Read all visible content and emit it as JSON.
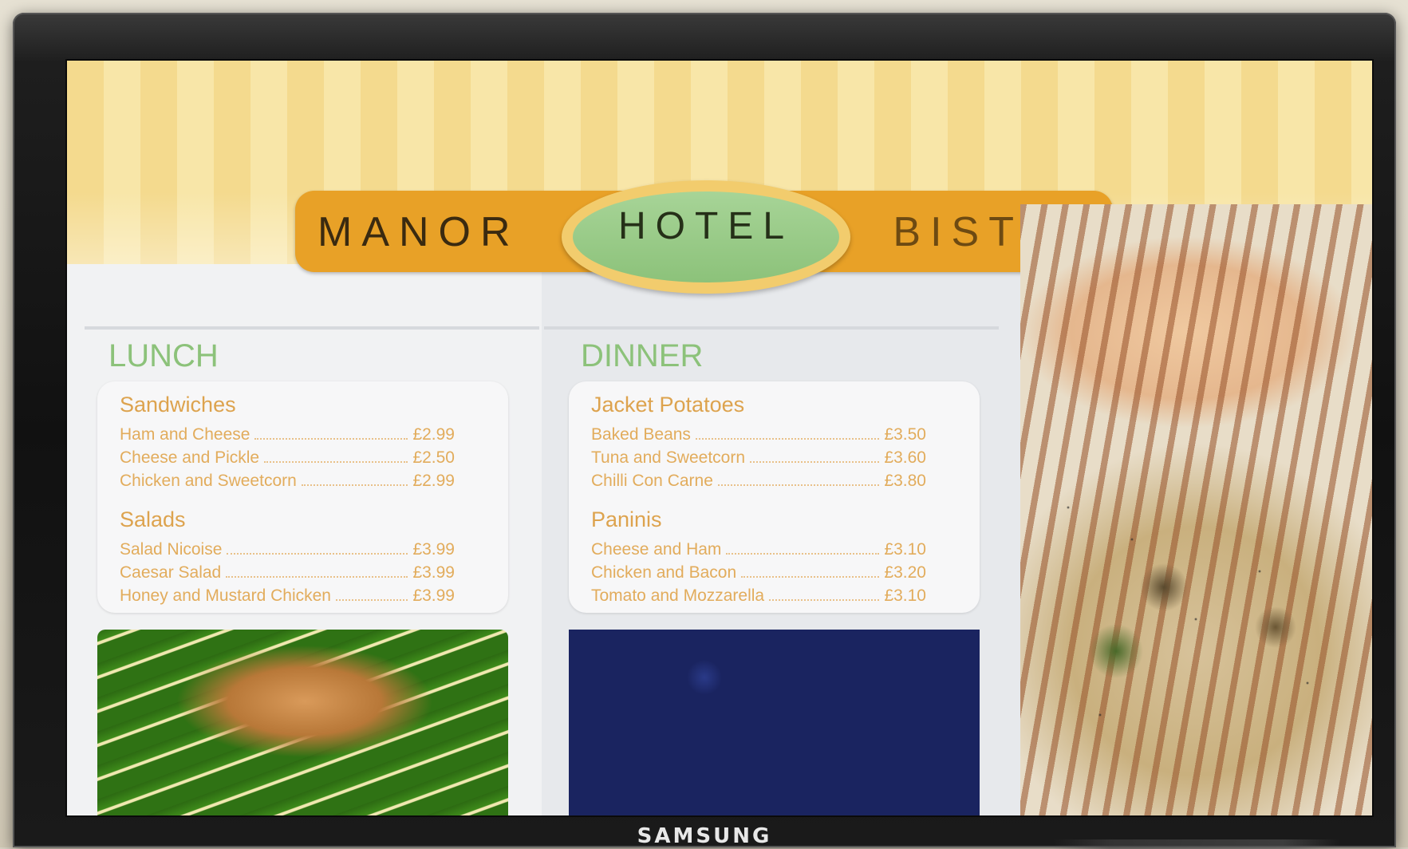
{
  "banner": {
    "left_word": "MANOR",
    "center_word": "HOTEL",
    "right_word": "BISTRO"
  },
  "lunch": {
    "title": "LUNCH",
    "groups": [
      {
        "category": "Sandwiches",
        "items": [
          {
            "name": "Ham and Cheese",
            "price": "£2.99"
          },
          {
            "name": "Cheese and Pickle",
            "price": "£2.50"
          },
          {
            "name": "Chicken and Sweetcorn",
            "price": "£2.99"
          }
        ]
      },
      {
        "category": "Salads",
        "items": [
          {
            "name": "Salad Nicoise",
            "price": "£3.99"
          },
          {
            "name": "Caesar Salad",
            "price": "£3.99"
          },
          {
            "name": "Honey and Mustard Chicken",
            "price": "£3.99"
          }
        ]
      }
    ]
  },
  "dinner": {
    "title": "DINNER",
    "groups": [
      {
        "category": "Jacket Potatoes",
        "items": [
          {
            "name": "Baked Beans",
            "price": "£3.50"
          },
          {
            "name": "Tuna and Sweetcorn",
            "price": "£3.60"
          },
          {
            "name": "Chilli Con Carne",
            "price": "£3.80"
          }
        ]
      },
      {
        "category": "Paninis",
        "items": [
          {
            "name": "Cheese and Ham",
            "price": "£3.10"
          },
          {
            "name": "Chicken and Bacon",
            "price": "£3.20"
          },
          {
            "name": "Tomato and Mozzarella",
            "price": "£3.10"
          }
        ]
      }
    ]
  },
  "monitor": {
    "brand": "SAMSUNG"
  },
  "colors": {
    "accent_orange": "#e8a127",
    "accent_green": "#8cc27a",
    "price_text": "#e2ac5c"
  }
}
